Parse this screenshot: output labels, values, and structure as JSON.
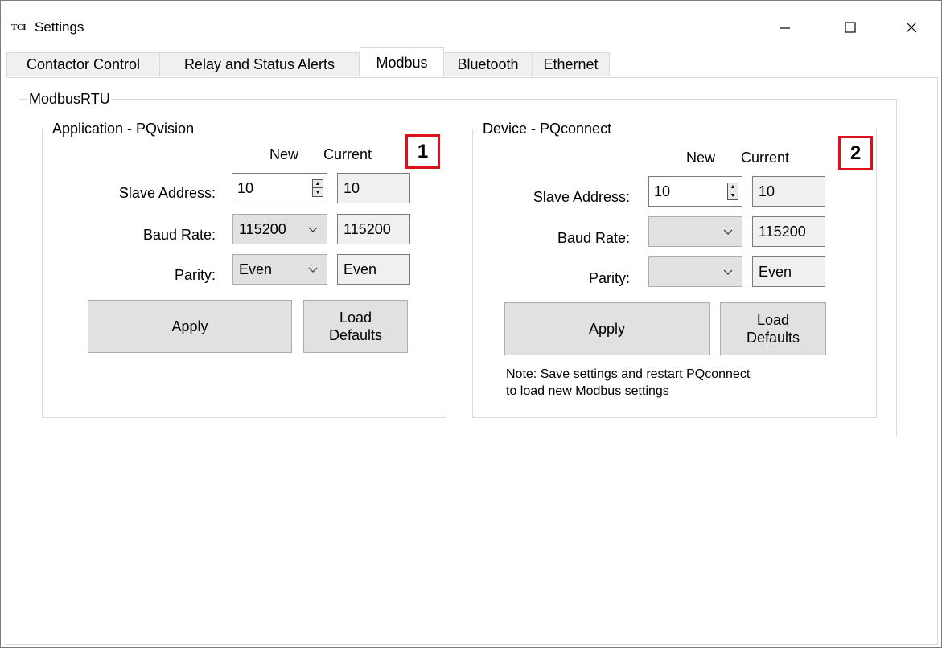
{
  "window": {
    "app_icon_text": "TCI",
    "title": "Settings"
  },
  "tabs": [
    {
      "label": "Contactor Control"
    },
    {
      "label": "Relay and Status Alerts"
    },
    {
      "label": "Modbus"
    },
    {
      "label": "Bluetooth"
    },
    {
      "label": "Ethernet"
    }
  ],
  "active_tab": "Modbus",
  "modbus": {
    "group_title": "ModbusRTU",
    "application": {
      "title": "Application - PQvision",
      "badge": "1",
      "col_new": "New",
      "col_current": "Current",
      "slave_address_label": "Slave Address:",
      "slave_address_new": "10",
      "slave_address_current": "10",
      "baud_rate_label": "Baud Rate:",
      "baud_rate_new": "115200",
      "baud_rate_current": "115200",
      "parity_label": "Parity:",
      "parity_new": "Even",
      "parity_current": "Even",
      "apply_label": "Apply",
      "load_defaults_label_line1": "Load",
      "load_defaults_label_line2": "Defaults"
    },
    "device": {
      "title": "Device - PQconnect",
      "badge": "2",
      "col_new": "New",
      "col_current": "Current",
      "slave_address_label": "Slave Address:",
      "slave_address_new": "10",
      "slave_address_current": "10",
      "baud_rate_label": "Baud Rate:",
      "baud_rate_new": "",
      "baud_rate_current": "115200",
      "parity_label": "Parity:",
      "parity_new": "",
      "parity_current": "Even",
      "apply_label": "Apply",
      "load_defaults_label_line1": "Load",
      "load_defaults_label_line2": "Defaults",
      "note_line1": "Note: Save settings and restart PQconnect",
      "note_line2": "to load new Modbus settings"
    }
  },
  "colors": {
    "badge_border": "#e0101a",
    "control_bg": "#e1e1e1",
    "readonly_bg": "#f0f0f0"
  }
}
